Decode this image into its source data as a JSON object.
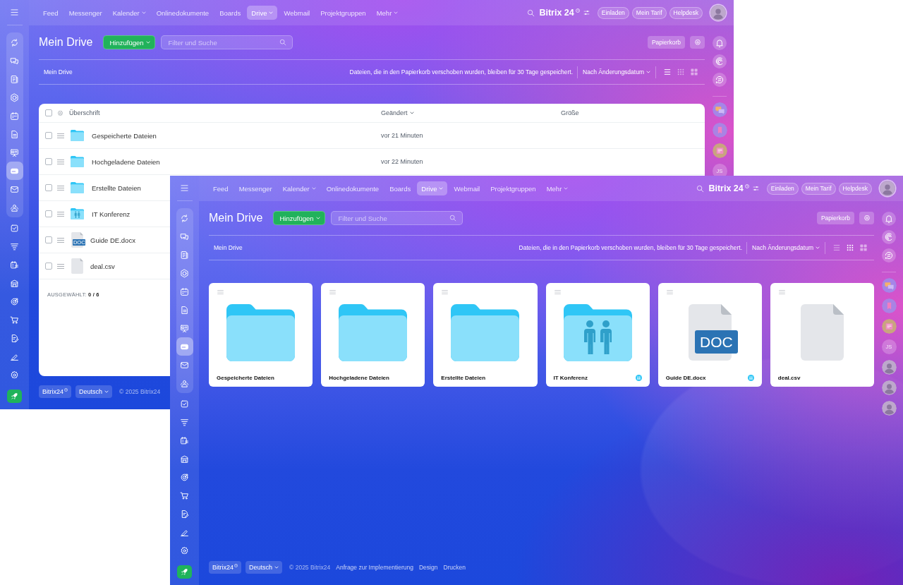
{
  "windows": [
    {
      "top_bar": {
        "nav": [
          {
            "label": "Feed",
            "selected": false,
            "has_menu": false
          },
          {
            "label": "Messenger",
            "selected": false,
            "has_menu": false
          },
          {
            "label": "Kalender",
            "selected": false,
            "has_menu": true
          },
          {
            "label": "Onlinedokumente",
            "selected": false,
            "has_menu": false
          },
          {
            "label": "Boards",
            "selected": false,
            "has_menu": false
          },
          {
            "label": "Drive",
            "selected": true,
            "has_menu": true
          },
          {
            "label": "Webmail",
            "selected": false,
            "has_menu": false
          },
          {
            "label": "Projektgruppen",
            "selected": false,
            "has_menu": false
          },
          {
            "label": "Mehr",
            "selected": false,
            "has_menu": true
          }
        ],
        "logo": "Bitrix 24",
        "buttons": [
          "Einladen",
          "Mein Tarif",
          "Helpdesk"
        ]
      },
      "sidebar": {
        "pinned": [
          {
            "selected": false
          },
          {
            "selected": false
          },
          {
            "selected": false
          },
          {
            "selected": false
          },
          {
            "selected": false
          },
          {
            "selected": false
          },
          {
            "selected": false
          },
          {
            "selected": true
          },
          {
            "selected": false
          },
          {
            "selected": false
          }
        ],
        "more": [
          {
            "selected": false
          },
          {
            "selected": false
          },
          {
            "selected": false
          },
          {
            "selected": false
          },
          {
            "selected": false
          },
          {
            "selected": false
          },
          {
            "selected": false
          },
          {
            "selected": false
          },
          {
            "selected": false
          }
        ]
      },
      "header": {
        "title": "Mein Drive",
        "add_button": "Hinzufügen",
        "search": {
          "placeholder": "Filter und Suche"
        },
        "trash_button": "Papierkorb"
      },
      "toolbar": {
        "breadcrumb": "Mein Drive",
        "notice": "Dateien, die in den Papierkorb verschoben wurden, bleiben für 30 Tage gespeichert.",
        "sort": "Nach Änderungsdatum",
        "view_modes": [
          {
            "selected": true
          },
          {
            "selected": false
          },
          {
            "selected": false
          }
        ]
      },
      "table": {
        "all_checked": false,
        "columns": [
          {
            "label": "Überschrift",
            "sorted": false
          },
          {
            "label": "Geändert",
            "sorted": true
          },
          {
            "label": "Größe",
            "sorted": false
          }
        ],
        "rows": [
          {
            "kind": "folder",
            "name": "Gespeicherte Dateien",
            "modified": "vor 21 Minuten",
            "checked": false
          },
          {
            "kind": "folder",
            "name": "Hochgeladene Dateien",
            "modified": "vor 22 Minuten",
            "checked": false
          },
          {
            "kind": "folder",
            "name": "Erstellte Dateien",
            "checked": false
          },
          {
            "kind": "group_folder",
            "name": "IT Konferenz",
            "checked": false
          },
          {
            "kind": "document",
            "name": "Guide DE.docx",
            "type_label": "DOC",
            "checked": false
          },
          {
            "kind": "file",
            "name": "deal.csv",
            "checked": false
          }
        ],
        "selection": "AUSGEWÄHLT: **0 / 6**"
      },
      "footer": {
        "brand": "Bitrix24",
        "language": "Deutsch",
        "copyright": "© 2025 Bitrix24"
      },
      "right_bar": {
        "contacts": [
          {
            "kind": "initials",
            "text": "JS"
          }
        ]
      }
    },
    {
      "top_bar": {
        "nav": [
          {
            "label": "Feed",
            "selected": false,
            "has_menu": false
          },
          {
            "label": "Messenger",
            "selected": false,
            "has_menu": false
          },
          {
            "label": "Kalender",
            "selected": false,
            "has_menu": true
          },
          {
            "label": "Onlinedokumente",
            "selected": false,
            "has_menu": false
          },
          {
            "label": "Boards",
            "selected": false,
            "has_menu": false
          },
          {
            "label": "Drive",
            "selected": true,
            "has_menu": true
          },
          {
            "label": "Webmail",
            "selected": false,
            "has_menu": false
          },
          {
            "label": "Projektgruppen",
            "selected": false,
            "has_menu": false
          },
          {
            "label": "Mehr",
            "selected": false,
            "has_menu": true
          }
        ],
        "logo": "Bitrix 24",
        "buttons": [
          "Einladen",
          "Mein Tarif",
          "Helpdesk"
        ]
      },
      "sidebar": {
        "pinned": [
          {
            "selected": false
          },
          {
            "selected": false
          },
          {
            "selected": false
          },
          {
            "selected": false
          },
          {
            "selected": false
          },
          {
            "selected": false
          },
          {
            "selected": false
          },
          {
            "selected": true
          },
          {
            "selected": false
          },
          {
            "selected": false
          }
        ],
        "more": [
          {
            "selected": false
          },
          {
            "selected": false
          },
          {
            "selected": false
          },
          {
            "selected": false
          },
          {
            "selected": false
          },
          {
            "selected": false
          },
          {
            "selected": false
          },
          {
            "selected": false
          },
          {
            "selected": false
          }
        ]
      },
      "header": {
        "title": "Mein Drive",
        "add_button": "Hinzufügen",
        "search": {
          "placeholder": "Filter und Suche"
        },
        "trash_button": "Papierkorb"
      },
      "toolbar": {
        "breadcrumb": "Mein Drive",
        "notice": "Dateien, die in den Papierkorb verschoben wurden, bleiben für 30 Tage gespeichert.",
        "sort": "Nach Änderungsdatum",
        "view_modes": [
          {
            "selected": false
          },
          {
            "selected": true
          },
          {
            "selected": false
          }
        ]
      },
      "files": [
        {
          "kind": "folder",
          "name": "Gespeicherte Dateien",
          "shared": false
        },
        {
          "kind": "folder",
          "name": "Hochgeladene Dateien",
          "shared": false
        },
        {
          "kind": "folder",
          "name": "Erstellte Dateien",
          "shared": false
        },
        {
          "kind": "group_folder",
          "name": "IT Konferenz",
          "shared": true
        },
        {
          "kind": "document",
          "name": "Guide DE.docx",
          "type_label": "DOC",
          "shared": true
        },
        {
          "kind": "file",
          "name": "deal.csv",
          "shared": false
        }
      ],
      "footer": {
        "brand": "Bitrix24",
        "language": "Deutsch",
        "copyright": "© 2025 Bitrix24",
        "links": [
          "Anfrage zur Implementierung",
          "Design",
          "Drucken"
        ]
      },
      "right_bar": {
        "contacts": [
          {
            "kind": "initials",
            "text": "JS"
          },
          {
            "kind": "photo"
          },
          {
            "kind": "photo"
          },
          {
            "kind": "photo"
          }
        ]
      }
    }
  ]
}
